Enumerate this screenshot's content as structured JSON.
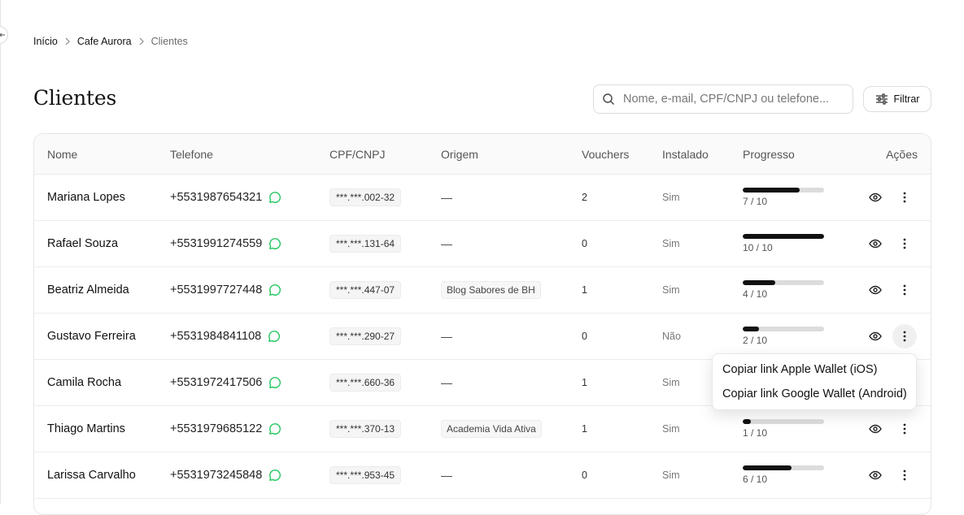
{
  "breadcrumb": {
    "home": "Início",
    "business": "Cafe Aurora",
    "current": "Clientes"
  },
  "page_title": "Clientes",
  "search": {
    "placeholder": "Nome, e-mail, CPF/CNPJ ou telefone..."
  },
  "filter_label": "Filtrar",
  "columns": {
    "name": "Nome",
    "phone": "Telefone",
    "cpf": "CPF/CNPJ",
    "origin": "Origem",
    "vouchers": "Vouchers",
    "installed": "Instalado",
    "progress": "Progresso",
    "actions": "Ações"
  },
  "rows": [
    {
      "name": "Mariana Lopes",
      "phone": "+5531987654321",
      "cpf": "***.***.002-32",
      "origin": "—",
      "vouchers": "2",
      "installed": "Sim",
      "progress_text": "7 / 10",
      "progress_fraction": 0.7
    },
    {
      "name": "Rafael Souza",
      "phone": "+5531991274559",
      "cpf": "***.***.131-64",
      "origin": "—",
      "vouchers": "0",
      "installed": "Sim",
      "progress_text": "10 / 10",
      "progress_fraction": 1.0
    },
    {
      "name": "Beatriz Almeida",
      "phone": "+5531997727448",
      "cpf": "***.***.447-07",
      "origin": "Blog Sabores de BH",
      "vouchers": "1",
      "installed": "Sim",
      "progress_text": "4 / 10",
      "progress_fraction": 0.4
    },
    {
      "name": "Gustavo Ferreira",
      "phone": "+5531984841108",
      "cpf": "***.***.290-27",
      "origin": "—",
      "vouchers": "0",
      "installed": "Não",
      "progress_text": "2 / 10",
      "progress_fraction": 0.2
    },
    {
      "name": "Camila Rocha",
      "phone": "+5531972417506",
      "cpf": "***.***.660-36",
      "origin": "—",
      "vouchers": "1",
      "installed": "Sim",
      "progress_text": "",
      "progress_fraction": 0
    },
    {
      "name": "Thiago Martins",
      "phone": "+5531979685122",
      "cpf": "***.***.370-13",
      "origin": "Academia Vida Ativa",
      "vouchers": "1",
      "installed": "Sim",
      "progress_text": "1 / 10",
      "progress_fraction": 0.1
    },
    {
      "name": "Larissa Carvalho",
      "phone": "+5531973245848",
      "cpf": "***.***.953-45",
      "origin": "—",
      "vouchers": "0",
      "installed": "Sim",
      "progress_text": "6 / 10",
      "progress_fraction": 0.6
    }
  ],
  "menu": {
    "apple": "Copiar link Apple Wallet (iOS)",
    "google": "Copiar link Google Wallet (Android)"
  },
  "colors": {
    "whatsapp": "#22c55e",
    "progress_fill": "#111111",
    "progress_track": "#dcdcdc"
  },
  "icons": {
    "search": "search-icon",
    "filter": "sliders-icon",
    "whatsapp": "whatsapp-icon",
    "view": "eye-icon",
    "more": "kebab-icon",
    "breadcrumb_sep": "chevron-right-icon"
  }
}
